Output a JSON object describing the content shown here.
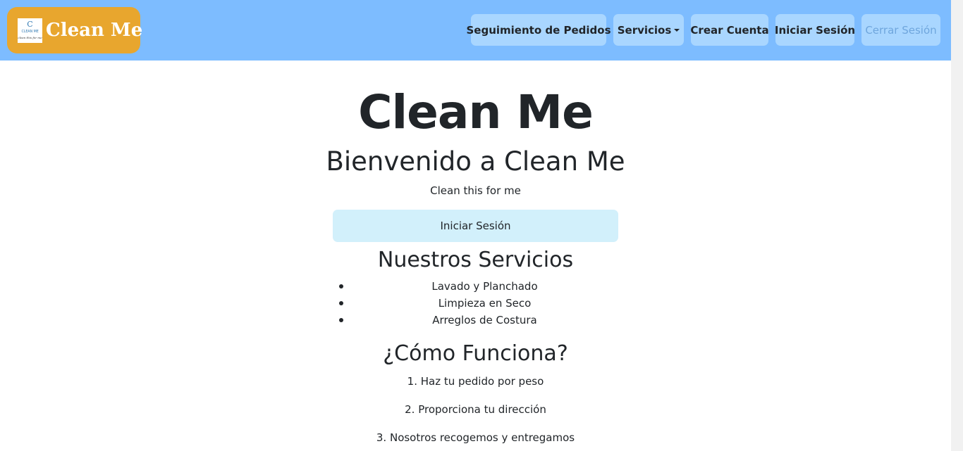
{
  "navbar": {
    "brand_text": "Clean Me",
    "logo": {
      "mark": "C",
      "text": "CLEAN ME",
      "slogan": "clean this for me"
    },
    "links": [
      {
        "label": "Seguimiento de Pedidos"
      },
      {
        "label": "Servicios"
      },
      {
        "label": "Crear Cuenta"
      },
      {
        "label": "Iniciar Sesión"
      },
      {
        "label": "Cerrar Sesión"
      }
    ]
  },
  "main": {
    "title": "Clean Me",
    "welcome": "Bienvenido a Clean Me",
    "tagline": "Clean this for me",
    "login_button": "Iniciar Sesión",
    "services_title": "Nuestros Servicios",
    "services": [
      "Lavado y Planchado",
      "Limpieza en Seco",
      "Arreglos de Costura"
    ],
    "how_title": "¿Cómo Funciona?",
    "steps": [
      "1. Haz tu pedido por peso",
      "2. Proporciona tu dirección",
      "3. Nosotros recogemos y entregamos"
    ]
  },
  "colors": {
    "navbar_bg": "#7dbcff",
    "brand_bg": "#e8a62e",
    "nav_button_bg": "#a9d6ff",
    "login_button_bg": "#d2f0fb"
  }
}
